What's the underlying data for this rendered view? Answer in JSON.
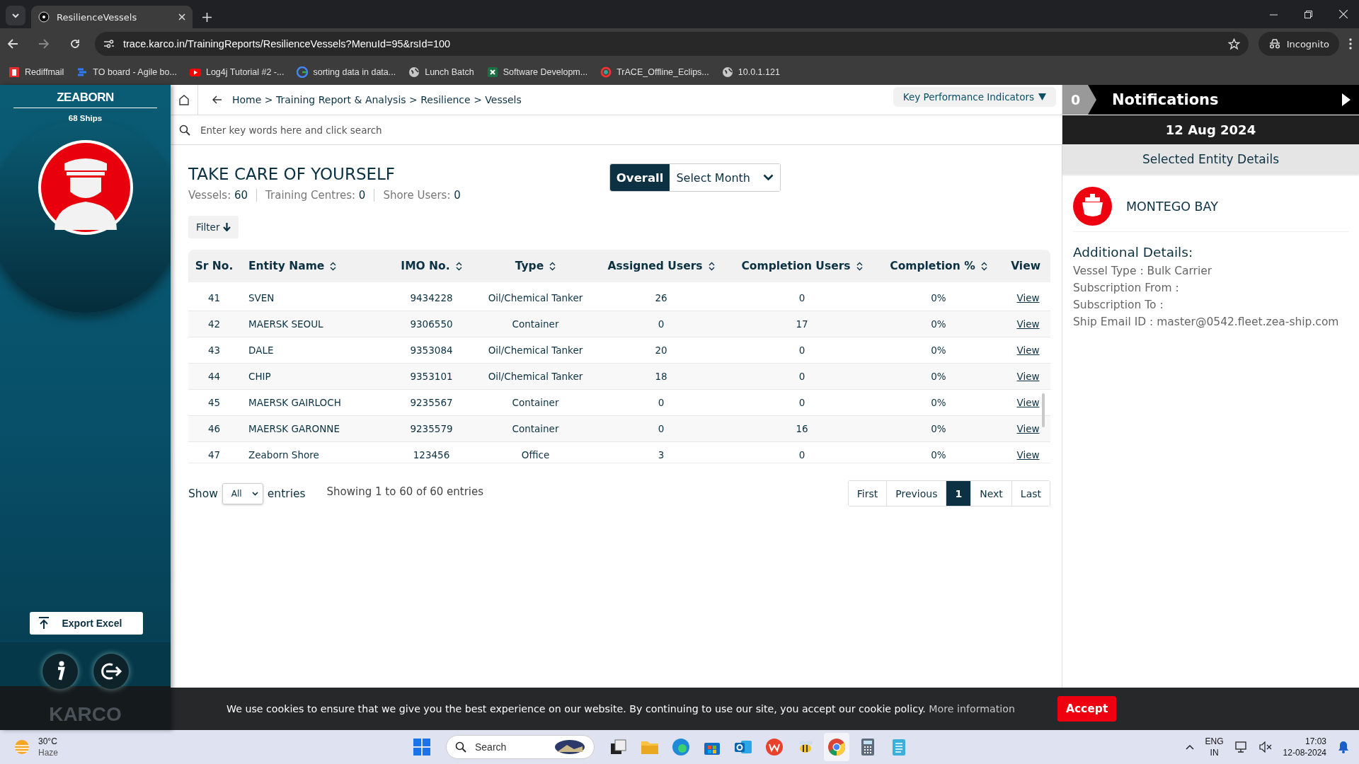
{
  "browser": {
    "tab_title": "ResilienceVessels",
    "url": "trace.karco.in/TrainingReports/ResilienceVessels?MenuId=95&rsId=100",
    "profile": "Incognito",
    "bookmarks": [
      "Rediffmail",
      "TO board - Agile bo...",
      "Log4j Tutorial #2 -...",
      "sorting data in data...",
      "Lunch Batch",
      "Software Developm...",
      "TrACE_Offline_Eclips...",
      "10.0.1.121"
    ]
  },
  "sidebar": {
    "brand": "ZEABORN",
    "ships": "68 Ships",
    "export_button": "Export Excel",
    "footer_logo": "KARCO"
  },
  "topbar": {
    "breadcrumb": "Home > Training Report & Analysis > Resilience > Vessels",
    "kpi_menu": "Key Performance Indicators",
    "search": {
      "placeholder": "Enter key words here and click search"
    }
  },
  "report": {
    "title": "TAKE CARE OF YOURSELF",
    "stats": [
      {
        "label": "Vessels:",
        "value": "60"
      },
      {
        "label": "Training Centres:",
        "value": "0"
      },
      {
        "label": "Shore Users:",
        "value": "0"
      }
    ],
    "period_toggle": [
      {
        "label": "Overall",
        "selected": true
      },
      {
        "label": "Select Month",
        "selected": false
      }
    ],
    "filter_button": "Filter",
    "table": {
      "columns": [
        {
          "label": "Sr No.",
          "sortable": false
        },
        {
          "label": "Entity Name",
          "sortable": true
        },
        {
          "label": "IMO No.",
          "sortable": true
        },
        {
          "label": "Type",
          "sortable": true
        },
        {
          "label": "Assigned Users",
          "sortable": true
        },
        {
          "label": "Completion Users",
          "sortable": true
        },
        {
          "label": "Completion %",
          "sortable": true
        },
        {
          "label": "View",
          "sortable": false
        }
      ],
      "rows": [
        [
          "41",
          "SVEN",
          "9434228",
          "Oil/Chemical Tanker",
          "26",
          "0",
          "0%",
          "View"
        ],
        [
          "42",
          "MAERSK SEOUL",
          "9306550",
          "Container",
          "0",
          "17",
          "0%",
          "View"
        ],
        [
          "43",
          "DALE",
          "9353084",
          "Oil/Chemical Tanker",
          "20",
          "0",
          "0%",
          "View"
        ],
        [
          "44",
          "CHIP",
          "9353101",
          "Oil/Chemical Tanker",
          "18",
          "0",
          "0%",
          "View"
        ],
        [
          "45",
          "MAERSK GAIRLOCH",
          "9235567",
          "Container",
          "0",
          "0",
          "0%",
          "View"
        ],
        [
          "46",
          "MAERSK GARONNE",
          "9235579",
          "Container",
          "0",
          "16",
          "0%",
          "View"
        ],
        [
          "47",
          "Zeaborn Shore",
          "123456",
          "Office",
          "3",
          "0",
          "0%",
          "View"
        ]
      ]
    },
    "length_menu": {
      "show": "Show",
      "value": "All",
      "entries": "entries"
    },
    "info": "Showing 1 to 60 of 60 entries",
    "pagination": [
      {
        "label": "First",
        "selected": false
      },
      {
        "label": "Previous",
        "selected": false
      },
      {
        "label": "1",
        "selected": true
      },
      {
        "label": "Next",
        "selected": false
      },
      {
        "label": "Last",
        "selected": false
      }
    ]
  },
  "notifications": {
    "count": "0",
    "title": "Notifications",
    "date": "12 Aug 2024",
    "section_title": "Selected Entity Details",
    "entity_name": "MONTEGO BAY",
    "details_heading": "Additional Details:",
    "details": [
      "Vessel Type : Bulk Carrier",
      "Subscription From :",
      "Subscription To :",
      "Ship Email ID : master@0542.fleet.zea-ship.com"
    ]
  },
  "cookie_bar": {
    "message": "We use cookies to ensure that we give you the best experience on our website. By continuing to use our site, you accept our cookie policy.",
    "link": "More information",
    "accept": "Accept"
  },
  "taskbar": {
    "temperature": "30°C",
    "weather": "Haze",
    "search": "Search",
    "language": "ENG",
    "region": "IN",
    "time": "17:03",
    "date": "12-08-2024"
  }
}
